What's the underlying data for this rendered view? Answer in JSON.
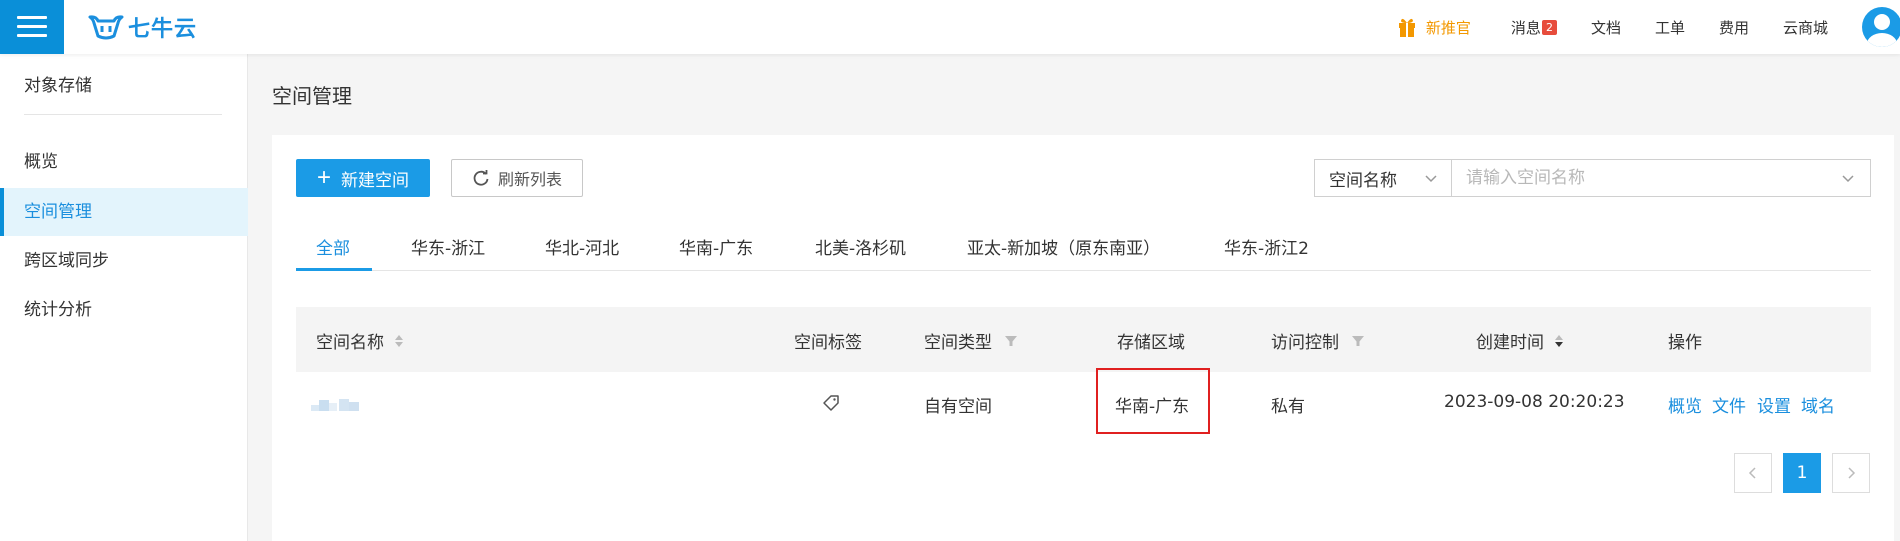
{
  "topbar": {
    "logo_text": "七牛云",
    "nav": [
      {
        "label": "新推官",
        "icon": "gift-icon"
      },
      {
        "label": "消息",
        "badge": "2"
      },
      {
        "label": "文档"
      },
      {
        "label": "工单"
      },
      {
        "label": "费用"
      },
      {
        "label": "云商城"
      }
    ]
  },
  "sidebar": {
    "title": "对象存储",
    "items": [
      {
        "label": "概览"
      },
      {
        "label": "空间管理",
        "active": true
      },
      {
        "label": "跨区域同步"
      },
      {
        "label": "统计分析"
      }
    ]
  },
  "main": {
    "page_title": "空间管理",
    "new_bucket_label": "新建空间",
    "refresh_label": "刷新列表",
    "search_field_selected": "空间名称",
    "search_placeholder": "请输入空间名称",
    "tabs": [
      "全部",
      "华东-浙江",
      "华北-河北",
      "华南-广东",
      "北美-洛杉矶",
      "亚太-新加坡（原东南亚）",
      "华东-浙江2"
    ],
    "active_tab": "全部",
    "table": {
      "headers": [
        "空间名称",
        "空间标签",
        "空间类型",
        "存储区域",
        "访问控制",
        "创建时间",
        "操作"
      ],
      "rows": [
        {
          "type": "自有空间",
          "region": "华南-广东",
          "access": "私有",
          "created": "2023-09-08 20:20:23",
          "actions": [
            "概览",
            "文件",
            "设置",
            "域名"
          ]
        }
      ]
    },
    "pagination": {
      "current": "1"
    }
  },
  "colors": {
    "accent": "#1b9be6",
    "promo": "#f39800",
    "highlight": "#e02020"
  }
}
